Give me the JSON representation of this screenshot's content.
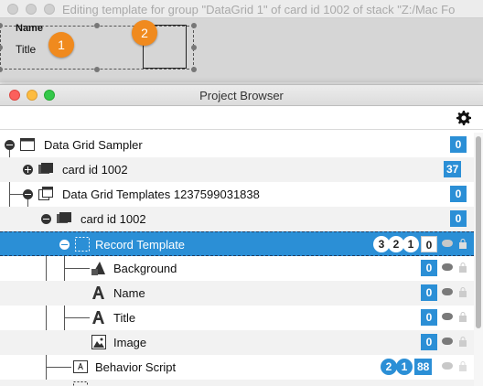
{
  "back_window": {
    "title": "Editing template for group \"DataGrid 1\" of card id 1002 of stack \"Z:/Mac Fo",
    "field_name_label": "Name",
    "field_title_label": "Title",
    "callout_1": "1",
    "callout_2": "2"
  },
  "project_browser": {
    "title": "Project Browser",
    "gear_icon": "gear-icon",
    "rows": [
      {
        "label": "Data Grid Sampler",
        "badge": "0"
      },
      {
        "label": "card id 1002",
        "badge": "37"
      },
      {
        "label": "Data Grid Templates 1237599031838",
        "badge": "0"
      },
      {
        "label": "card id 1002",
        "badge": "0"
      },
      {
        "label": "Record Template",
        "badges": [
          "3",
          "2",
          "1",
          "0"
        ]
      },
      {
        "label": "Background",
        "badge": "0"
      },
      {
        "label": "Name",
        "badge": "0"
      },
      {
        "label": "Title",
        "badge": "0"
      },
      {
        "label": "Image",
        "badge": "0"
      },
      {
        "label": "Behavior Script",
        "badges": [
          "2",
          "1",
          "88"
        ]
      }
    ]
  },
  "colors": {
    "accent": "#2b8fd6",
    "callout": "#f08a1e",
    "selection": "#2b8fd6"
  }
}
